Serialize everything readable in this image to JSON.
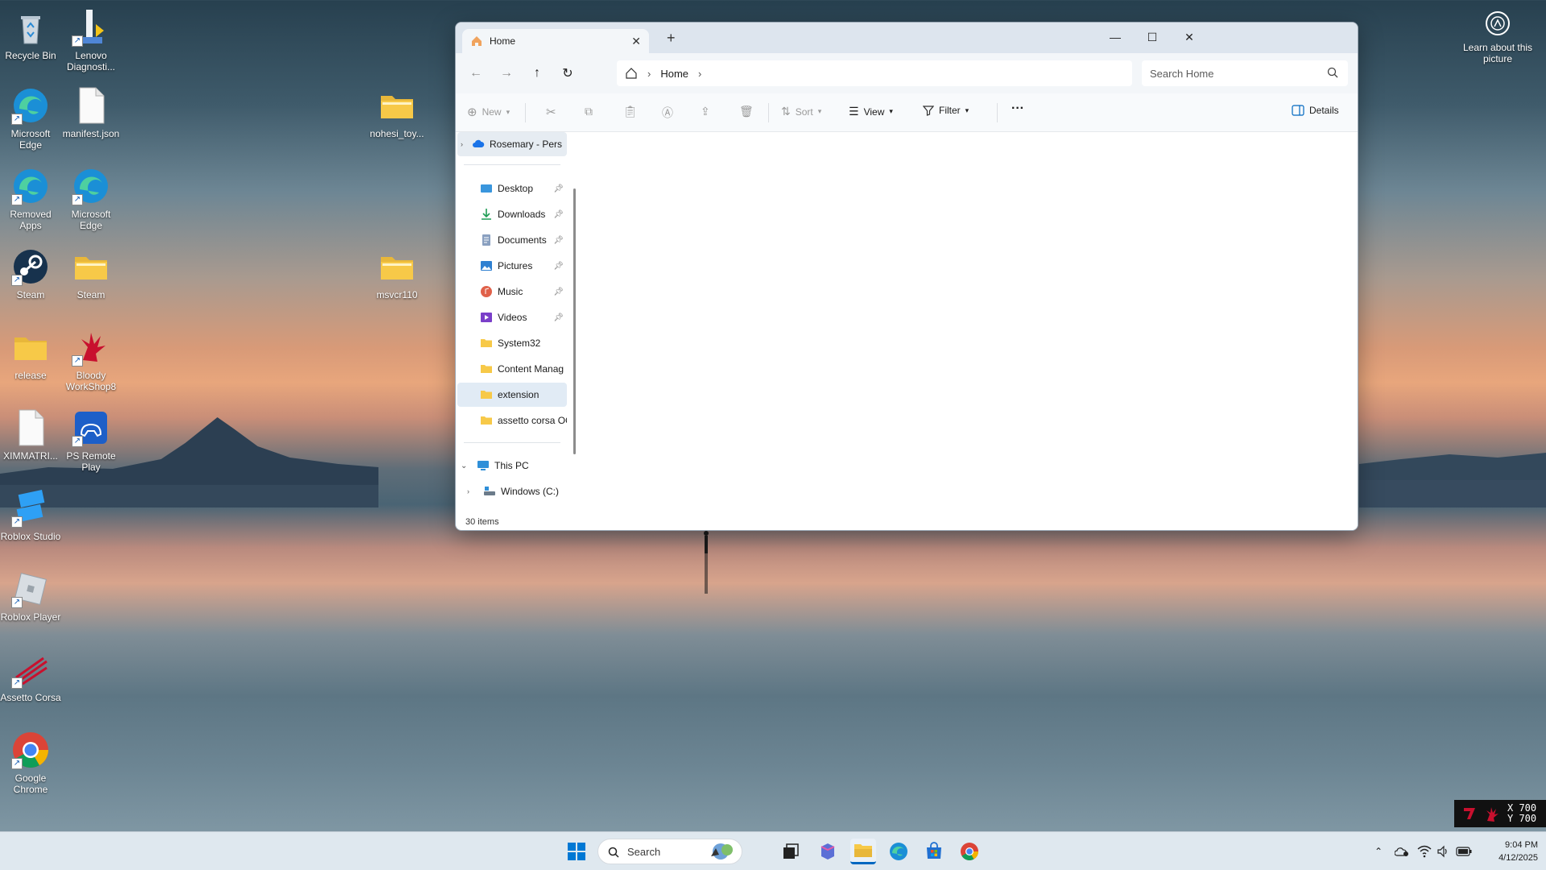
{
  "desktop": {
    "icons": [
      {
        "label": "Recycle Bin"
      },
      {
        "label": "Lenovo Diagnosti..."
      },
      {
        "label": "Microsoft Edge"
      },
      {
        "label": "manifest.json"
      },
      {
        "label": "nohesi_toy..."
      },
      {
        "label": "Removed Apps"
      },
      {
        "label": "Microsoft Edge"
      },
      {
        "label": "Steam"
      },
      {
        "label": "Steam"
      },
      {
        "label": "msvcr110"
      },
      {
        "label": "release"
      },
      {
        "label": "Bloody WorkShop8"
      },
      {
        "label": "XIMMATRI..."
      },
      {
        "label": "PS Remote Play"
      },
      {
        "label": "Roblox Studio"
      },
      {
        "label": "Roblox Player"
      },
      {
        "label": "Assetto Corsa"
      },
      {
        "label": "Google Chrome"
      }
    ],
    "learn_about": "Learn about this picture"
  },
  "explorer": {
    "tab_title": "Home",
    "breadcrumb": "Home",
    "search_placeholder": "Search Home",
    "toolbar": {
      "new": "New",
      "sort": "Sort",
      "view": "View",
      "filter": "Filter",
      "more": "···",
      "details": "Details"
    },
    "nav": {
      "onedrive": "Rosemary - Pers",
      "quick": [
        {
          "label": "Desktop",
          "pinned": true
        },
        {
          "label": "Downloads",
          "pinned": true
        },
        {
          "label": "Documents",
          "pinned": true
        },
        {
          "label": "Pictures",
          "pinned": true
        },
        {
          "label": "Music",
          "pinned": true
        },
        {
          "label": "Videos",
          "pinned": true
        },
        {
          "label": "System32",
          "pinned": false
        },
        {
          "label": "Content Manag",
          "pinned": false
        },
        {
          "label": "extension",
          "pinned": false
        },
        {
          "label": "assetto corsa OC",
          "pinned": false
        }
      ],
      "this_pc": "This PC",
      "drive": "Windows (C:)"
    },
    "status": "30 items"
  },
  "mouse_overlay": {
    "x": "X 700",
    "y": "Y 700"
  },
  "taskbar": {
    "search": "Search",
    "time": "9:04 PM",
    "date": "4/12/2025"
  },
  "colors": {
    "accent": "#0067c0",
    "folder": "#f7c948",
    "selected": "#e1ebf5"
  }
}
